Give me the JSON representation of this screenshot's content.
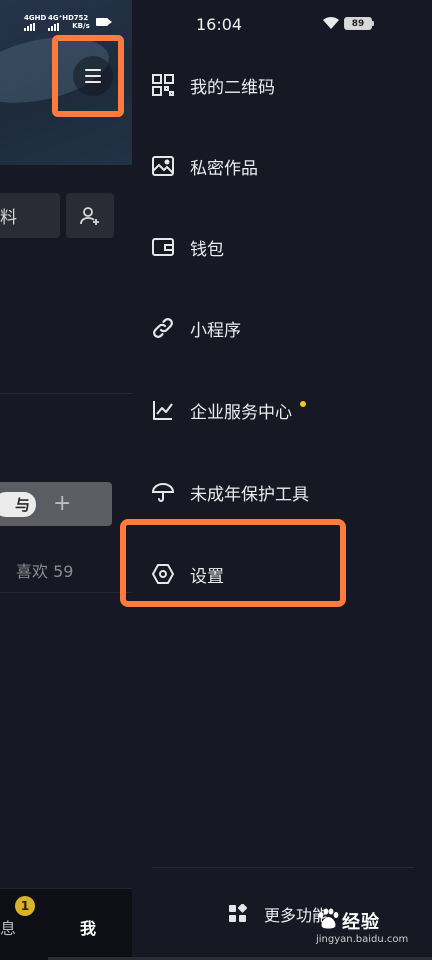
{
  "status_bar": {
    "sim1": "4GHD",
    "sim2": "4G⁺HD",
    "speed_value": "752",
    "speed_unit": "KB/s",
    "time": "16:04",
    "battery": "89"
  },
  "profile_bg": {
    "edit_fragment": "料",
    "promo_text": "与",
    "promo_plus": "+",
    "likes_label": "喜欢 59",
    "tabs": {
      "messages": "息",
      "me": "我"
    },
    "messages_badge": "1"
  },
  "drawer": {
    "items": [
      {
        "label": "我的二维码",
        "icon": "qr-code-icon"
      },
      {
        "label": "私密作品",
        "icon": "private-image-icon"
      },
      {
        "label": "钱包",
        "icon": "wallet-icon"
      },
      {
        "label": "小程序",
        "icon": "link-icon"
      },
      {
        "label": "企业服务中心",
        "icon": "chart-icon",
        "has_dot": true
      },
      {
        "label": "未成年保护工具",
        "icon": "umbrella-icon"
      },
      {
        "label": "设置",
        "icon": "settings-hexagon-icon"
      }
    ],
    "more_label": "更多功能"
  },
  "watermark": {
    "main": "经验",
    "sub": "jingyan.baidu.com"
  },
  "colors": {
    "highlight": "#ff7a3d",
    "background": "#161823",
    "notification_dot": "#f5c518"
  }
}
